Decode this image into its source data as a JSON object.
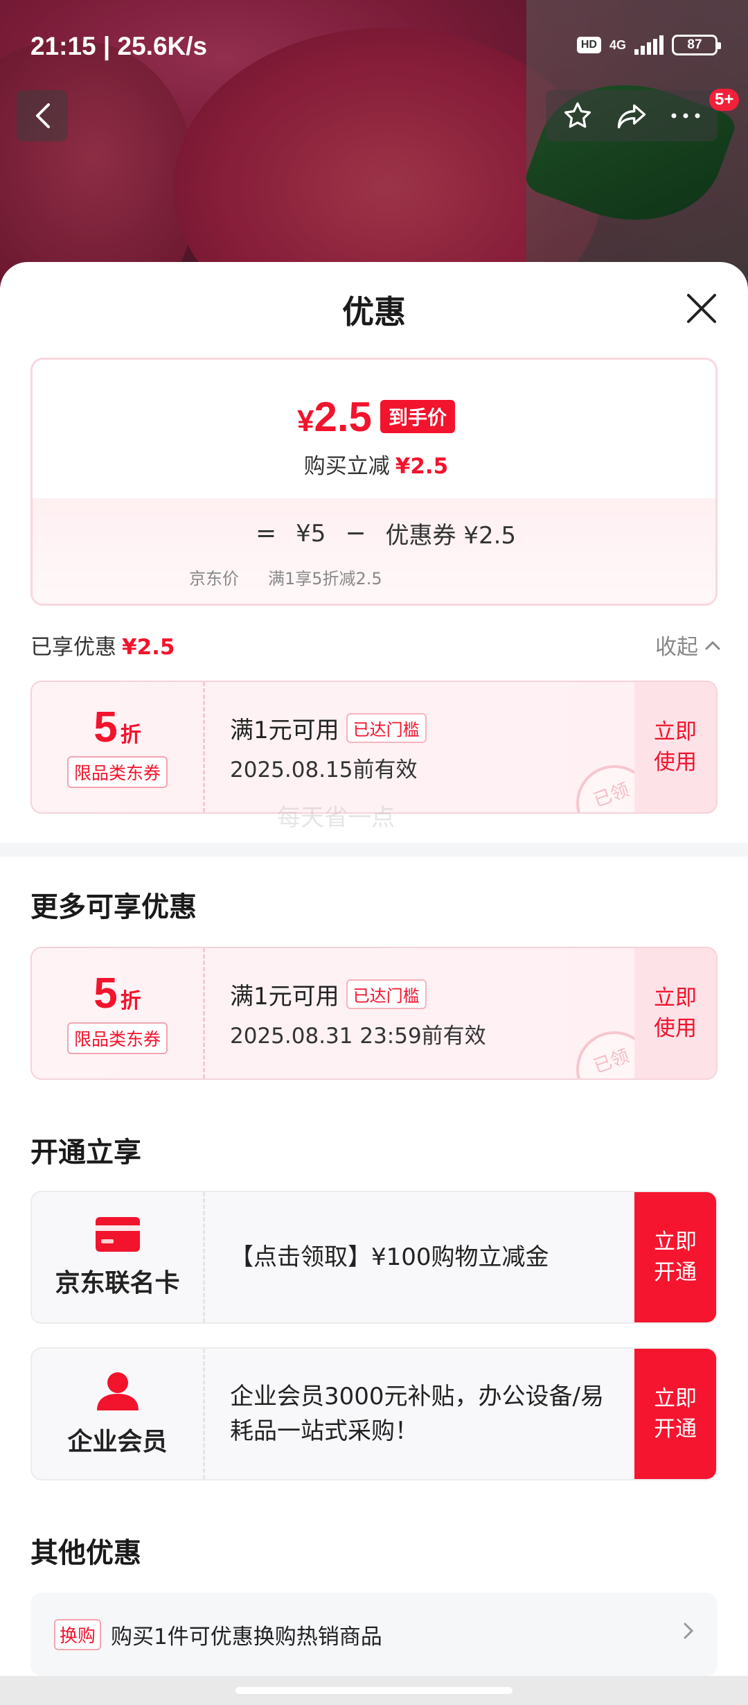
{
  "status_bar": {
    "time": "21:15 | 25.6K/s",
    "hd": "HD",
    "network": "4G",
    "battery": "87"
  },
  "nav": {
    "badge": "5+"
  },
  "sheet": {
    "title": "优惠"
  },
  "price_card": {
    "currency": "¥",
    "final_price": "2.5",
    "final_tag": "到手价",
    "reduce_label": "购买立减",
    "reduce_value": "¥2.5",
    "equals": "=",
    "base_price": "¥5",
    "minus": "−",
    "coupon_part": "优惠券 ¥2.5",
    "base_caption": "京东价",
    "coupon_caption": "满1享5折减2.5"
  },
  "enjoyed": {
    "label": "已享优惠",
    "value": "¥2.5",
    "collapse_label": "收起"
  },
  "coupons": [
    {
      "discount": "5",
      "unit": "折",
      "kind": "限品类东券",
      "condition": "满1元可用",
      "reached": "已达门槛",
      "validity": "2025.08.15前有效",
      "action": "立即使用",
      "stamp": "已领"
    },
    {
      "discount": "5",
      "unit": "折",
      "kind": "限品类东券",
      "condition": "满1元可用",
      "reached": "已达门槛",
      "validity": "2025.08.31 23:59前有效",
      "action": "立即使用",
      "stamp": "已领"
    }
  ],
  "watermark": "每天省一点",
  "sections": {
    "more": "更多可享优惠",
    "open": "开通立享",
    "other": "其他优惠"
  },
  "memberships": [
    {
      "icon": "credit-card-icon",
      "name": "京东联名卡",
      "description": "【点击领取】¥100购物立减金",
      "action": "立即开通"
    },
    {
      "icon": "user-icon",
      "name": "企业会员",
      "description": "企业会员3000元补贴，办公设备/易耗品一站式采购！",
      "action": "立即开通"
    }
  ],
  "other": {
    "tag": "换购",
    "text": "购买1件可优惠换购热销商品"
  },
  "colors": {
    "accent_red": "#f2132d",
    "coupon_bg": "#fff3f5"
  }
}
